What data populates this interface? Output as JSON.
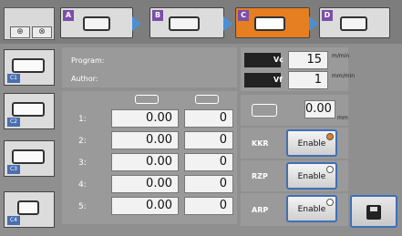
{
  "topbar": {
    "corner_text": "",
    "tabs": [
      {
        "letter": "A",
        "name": "tab-a",
        "active": false
      },
      {
        "letter": "B",
        "name": "tab-b",
        "active": false
      },
      {
        "letter": "C",
        "name": "tab-c",
        "active": true
      },
      {
        "letter": "D",
        "name": "tab-d",
        "active": false
      }
    ]
  },
  "program": {
    "program_label": "Program:",
    "author_label": "Author:"
  },
  "table": {
    "rows": [
      {
        "index": "1:",
        "value": "0.00",
        "count": "0"
      },
      {
        "index": "2:",
        "value": "0.00",
        "count": "0"
      },
      {
        "index": "3:",
        "value": "0.00",
        "count": "0"
      },
      {
        "index": "4:",
        "value": "0.00",
        "count": "0"
      },
      {
        "index": "5:",
        "value": "0.00",
        "count": "0"
      }
    ]
  },
  "speeds": {
    "vc_label": "Vc",
    "vc_value": "15",
    "vc_unit": "m/min",
    "vf_label": "Vf",
    "vf_value": "1",
    "vf_unit": "mm/min",
    "length_value": "0.00",
    "length_unit": "mm"
  },
  "functions": [
    {
      "label": "KKR",
      "button": "Enable",
      "on": true
    },
    {
      "label": "RZP",
      "button": "Enable",
      "on": false
    },
    {
      "label": "ARP",
      "button": "Enable",
      "on": false
    }
  ],
  "sidebar": {
    "tags": [
      "C1",
      "C2",
      "C3",
      "C4"
    ]
  },
  "colors": {
    "accent_active_tab": "#e67e22",
    "button_border": "#3f6fb7",
    "tab_letter_bg": "#7b4fa8"
  }
}
